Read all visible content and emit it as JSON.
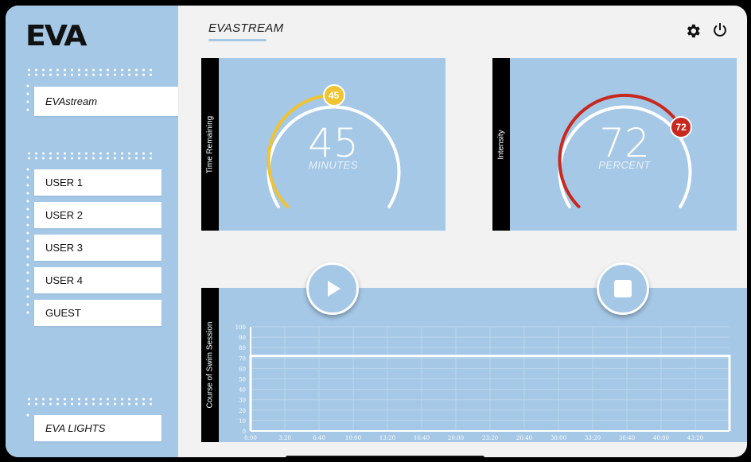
{
  "app": {
    "logo": "EVA"
  },
  "sidebar": {
    "stream_item": "EVAstream",
    "users": [
      "USER 1",
      "USER 2",
      "USER 3",
      "USER 4",
      "GUEST"
    ],
    "lights_item": "EVA LIGHTS"
  },
  "header": {
    "title": "EVASTREAM",
    "settings_icon": "gear-icon",
    "power_icon": "power-icon"
  },
  "time_card": {
    "side_label": "Time Remaining",
    "value": "45",
    "unit": "MINUTES",
    "badge": "45",
    "color": "#f0c330"
  },
  "intensity_card": {
    "side_label": "Intensity",
    "value": "72",
    "unit": "PERCENT",
    "badge": "72",
    "color": "#c8281e"
  },
  "controls": {
    "play_icon": "play-icon",
    "stop_icon": "stop-icon"
  },
  "session_card": {
    "side_label": "Course of Swim Session"
  },
  "chart_data": {
    "type": "line",
    "x": [
      "0:00",
      "3:20",
      "6:40",
      "10:00",
      "13:20",
      "16:40",
      "20:00",
      "23:20",
      "26:40",
      "30:00",
      "33:20",
      "36:40",
      "40:00",
      "43:20"
    ],
    "y_ticks": [
      "100",
      "90",
      "80",
      "70",
      "60",
      "50",
      "40",
      "30",
      "20",
      "10",
      "0"
    ],
    "ylim": [
      0,
      100
    ],
    "series": [
      {
        "values": [
          72,
          72,
          72,
          72,
          72,
          72,
          72,
          72,
          72,
          72,
          72,
          72,
          72,
          72
        ]
      }
    ],
    "grid": true
  }
}
